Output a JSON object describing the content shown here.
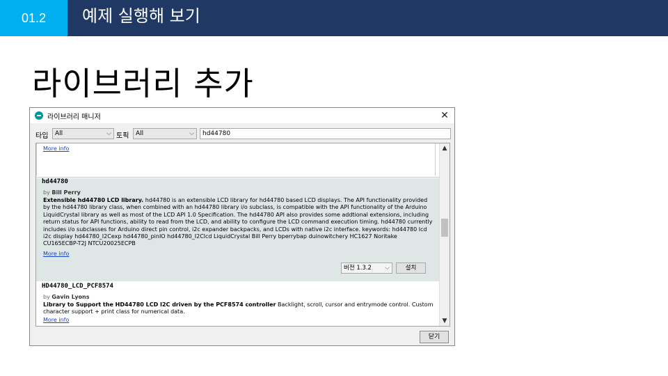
{
  "slide": {
    "section_number": "01.2",
    "section_title": "예제 실행해 보기",
    "heading": "라이브러리 추가"
  },
  "window": {
    "title": "라이브러리 매니저",
    "close_glyph": "✕",
    "type_label": "타입",
    "type_value": "All",
    "topic_label": "토픽",
    "topic_value": "All",
    "search_value": "hd44780",
    "close_button": "닫기"
  },
  "libraries": [
    {
      "more_info": "More info"
    },
    {
      "name": "hd44780",
      "by_prefix": "by",
      "author": "Bill Perry",
      "summary": "Extensible hd44780 LCD library.",
      "description": "hd44780 is an extensible LCD library for hd44780 based LCD displays. The API functionality provided by the hd44780 library class, when combined with an hd44780 library i/o subclass, is compatible with the API functionality of the Arduino LiquidCrystal library as well as most of the LCD API 1.0 Specification. The hd44780 API also provides some addtional extensions, including return status for API functions, ability to read from the LCD, and ability to configure the LCD command execution timing. hd44780 currently includes i/o subclasses for Arduino direct pin control, i2c expander backpacks, and LCDs with native i2c interface. keywords: hd44780 lcd i2c display hd44780_I2Cexp hd44780_pinIO hd44780_I2Clcd LiquidCrystal Bill Perry bperrybap duinowitchery HC1627 Noritake CU165ECBP-T2J NTCU20025ECPB",
      "more_info": "More info",
      "version": "버전 1.3.2",
      "install": "설치"
    },
    {
      "name": "HD44780_LCD_PCF8574",
      "by_prefix": "by",
      "author": "Gavin Lyons",
      "summary": "Library to Support the HD44780 LCD I2C driven by the PCF8574 controller",
      "description": "Backlight, scroll, cursor and entrymode control. Custom character support + print class for numerical data.",
      "more_info": "More info"
    }
  ],
  "icons": {
    "dropdown": "⌵",
    "scroll_up": "▲",
    "scroll_down": "▼"
  }
}
